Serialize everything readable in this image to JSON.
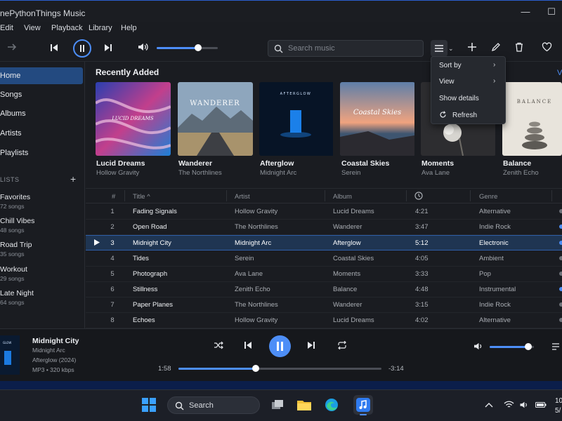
{
  "window": {
    "title": "nePythonThings Music",
    "minimize": "—",
    "maximize": "☐"
  },
  "menu": [
    "Edit",
    "View",
    "Playback",
    "Library",
    "Help"
  ],
  "search": {
    "placeholder": "Search music"
  },
  "sidebar": {
    "nav": [
      {
        "label": "Home",
        "active": true
      },
      {
        "label": "Songs"
      },
      {
        "label": "Albums"
      },
      {
        "label": "Artists"
      },
      {
        "label": "Playlists"
      }
    ],
    "lists_header": "LISTS",
    "playlists": [
      {
        "name": "Favorites",
        "count": "72 songs"
      },
      {
        "name": "Chill Vibes",
        "count": "48 songs"
      },
      {
        "name": "Road Trip",
        "count": "35 songs"
      },
      {
        "name": "Workout",
        "count": "29 songs"
      },
      {
        "name": "Late Night",
        "count": "64 songs"
      }
    ]
  },
  "recent": {
    "title": "Recently Added",
    "view_all": "V",
    "albums": [
      {
        "title": "Lucid Dreams",
        "artist": "Hollow Gravity",
        "cover_text": "LUCID DREAMS"
      },
      {
        "title": "Wanderer",
        "artist": "The Northlines",
        "cover_text": "WANDERER"
      },
      {
        "title": "Afterglow",
        "artist": "Midnight Arc",
        "cover_text": "AFTERGLOW"
      },
      {
        "title": "Coastal Skies",
        "artist": "Serein",
        "cover_text": "Coastal Skies"
      },
      {
        "title": "Moments",
        "artist": "Ava Lane",
        "cover_text": ""
      },
      {
        "title": "Balance",
        "artist": "Zenith Echo",
        "cover_text": "BALANCE"
      }
    ]
  },
  "dropdown": {
    "items": [
      {
        "label": "Sort by",
        "submenu": true
      },
      {
        "label": "View",
        "submenu": true
      },
      {
        "label": "Show details",
        "submenu": false
      },
      {
        "label": "Refresh",
        "submenu": false
      }
    ]
  },
  "table": {
    "headers": {
      "num": "#",
      "title": "Title ^",
      "artist": "Artist",
      "album": "Album",
      "genre": "Genre"
    },
    "rows": [
      {
        "n": "1",
        "title": "Fading Signals",
        "artist": "Hollow Gravity",
        "album": "Lucid Dreams",
        "time": "4:21",
        "genre": "Alternative",
        "fav": false
      },
      {
        "n": "2",
        "title": "Open Road",
        "artist": "The Northlines",
        "album": "Wanderer",
        "time": "3:47",
        "genre": "Indie Rock",
        "fav": true
      },
      {
        "n": "3",
        "title": "Midnight City",
        "artist": "Midnight Arc",
        "album": "Afterglow",
        "time": "5:12",
        "genre": "Electronic",
        "fav": true
      },
      {
        "n": "4",
        "title": "Tides",
        "artist": "Serein",
        "album": "Coastal Skies",
        "time": "4:05",
        "genre": "Ambient",
        "fav": false
      },
      {
        "n": "5",
        "title": "Photograph",
        "artist": "Ava Lane",
        "album": "Moments",
        "time": "3:33",
        "genre": "Pop",
        "fav": false
      },
      {
        "n": "6",
        "title": "Stillness",
        "artist": "Zenith Echo",
        "album": "Balance",
        "time": "4:48",
        "genre": "Instrumental",
        "fav": true
      },
      {
        "n": "7",
        "title": "Paper Planes",
        "artist": "The Northlines",
        "album": "Wanderer",
        "time": "3:15",
        "genre": "Indie Rock",
        "fav": false
      },
      {
        "n": "8",
        "title": "Echoes",
        "artist": "Hollow Gravity",
        "album": "Lucid Dreams",
        "time": "4:02",
        "genre": "Alternative",
        "fav": false
      }
    ]
  },
  "now_playing": {
    "title": "Midnight City",
    "artist": "Midnight Arc",
    "album": "Afterglow (2024)",
    "format": "MP3 • 320 kbps",
    "elapsed": "1:58",
    "remaining": "-3:14",
    "progress_fraction": 0.38,
    "volume_fraction": 0.88,
    "art_text": "GLOW"
  },
  "toolbar": {
    "volume_fraction": 0.68
  },
  "taskbar": {
    "search_label": "Search",
    "clock": "10",
    "date": "5/"
  },
  "colors": {
    "accent": "#4d8ef7",
    "active_row": "#1f3552",
    "nav_active": "#234a80"
  }
}
